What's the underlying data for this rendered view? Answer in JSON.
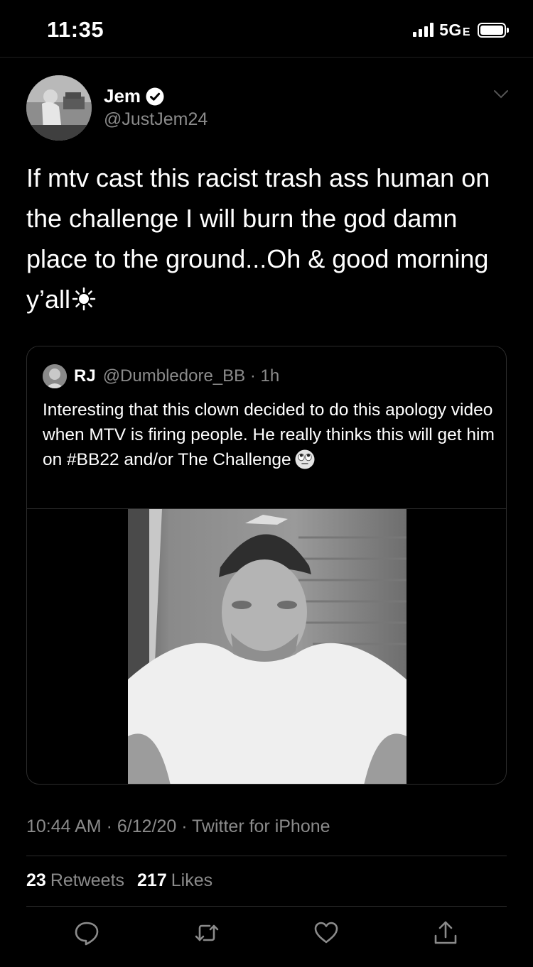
{
  "status_bar": {
    "time": "11:35",
    "network": "5G",
    "network_suffix": "E"
  },
  "tweet": {
    "author_name": "Jem",
    "author_handle": "@JustJem24",
    "text": "If mtv cast this racist trash ass human on the challenge I will burn the god damn place to the ground...Oh & good morning y’all",
    "timestamp": "10:44 AM · 6/12/20 · Twitter for iPhone",
    "retweets_count": "23",
    "retweets_label": "Retweets",
    "likes_count": "217",
    "likes_label": "Likes"
  },
  "quote": {
    "author_name": "RJ",
    "author_handle": "@Dumbledore_BB · 1h",
    "text": "Interesting that this clown decided to do this apology video when MTV is firing people. He really thinks this will get him on #BB22 and/or The Challenge"
  },
  "icons": {
    "verified": "verified-badge-icon",
    "chevron": "chevron-down-icon",
    "sun": "sun-emoji-icon",
    "eyeroll": "face-with-rolling-eyes-icon",
    "reply": "reply-icon",
    "retweet": "retweet-icon",
    "like": "heart-icon",
    "share": "share-icon"
  },
  "colors": {
    "background": "#000000",
    "text": "#ffffff",
    "secondary": "#8b8b8b",
    "border": "#2c2c2c"
  }
}
